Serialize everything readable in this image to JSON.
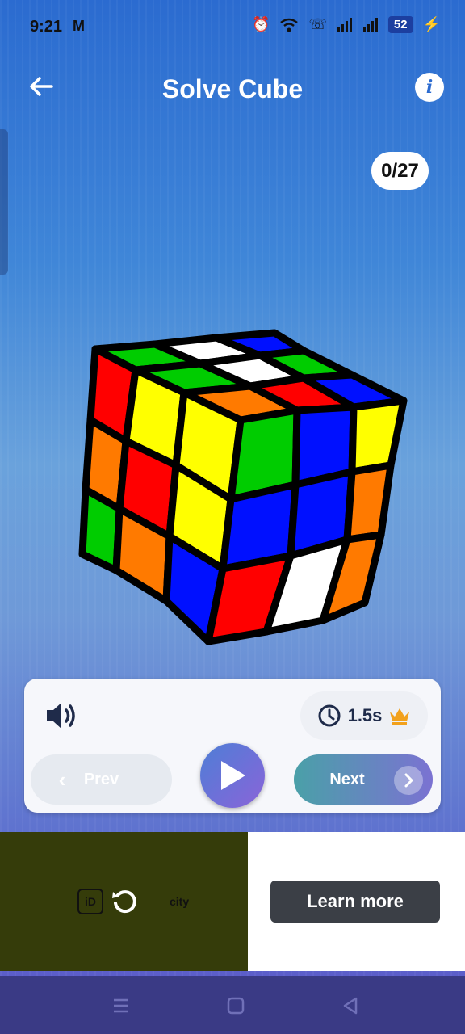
{
  "status": {
    "time": "9:21",
    "mail_icon": "M",
    "battery": "52"
  },
  "header": {
    "title": "Solve Cube",
    "info": "i"
  },
  "progress": "0/27",
  "controls": {
    "timer": "1.5s",
    "prev_label": "Prev",
    "next_label": "Next"
  },
  "ad": {
    "logo_text": "city",
    "learn_more": "Learn more"
  },
  "colors": {
    "accent": "#2b6bd0",
    "card": "#f6f7fb",
    "crown": "#f2a11c",
    "ad_left": "#353c0a",
    "nav": "#3a3a85"
  }
}
